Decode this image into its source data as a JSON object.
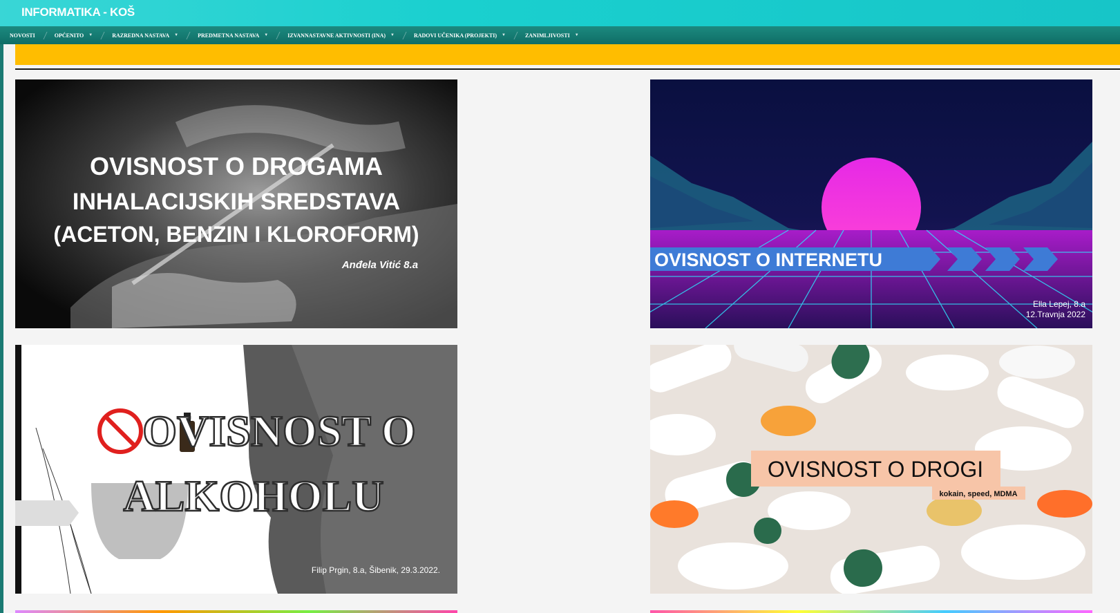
{
  "site": {
    "title": "INFORMATIKA - KOŠ"
  },
  "nav": {
    "items": [
      {
        "label": "NOVOSTI",
        "dropdown": false
      },
      {
        "label": "OPĆENITO",
        "dropdown": true
      },
      {
        "label": "RAZREDNA NASTAVA",
        "dropdown": true
      },
      {
        "label": "PREDMETNA NASTAVA",
        "dropdown": true
      },
      {
        "label": "IZVANNASTAVNE AKTIVNOSTI (INA)",
        "dropdown": true
      },
      {
        "label": "RADOVI UČENIKA (PROJEKTI)",
        "dropdown": true
      },
      {
        "label": "ZANIMLJIVOSTI",
        "dropdown": true
      }
    ],
    "caret": "▼"
  },
  "colors": {
    "topbar": "#1ad0cf",
    "navbar": "#0f6d66",
    "banner": "#ffbd00"
  },
  "cards": [
    {
      "line1": "OVISNOST O DROGAMA",
      "line2": "INHALACIJSKIH SREDSTAVA",
      "line3": "(ACETON, BENZIN I KLOROFORM)",
      "author": "Anđela Vitić 8.a"
    },
    {
      "title": "OVISNOST O INTERNETU",
      "author": "Ella Lepej, 8.a",
      "date": "12.Travnja 2022"
    },
    {
      "line1": "OVISNOST O",
      "line2": "ALKOHOLU",
      "author": "Filip Prgin, 8.a, Šibenik, 29.3.2022."
    },
    {
      "title": "OVISNOST O DROGI",
      "subtitle": "kokain, speed, MDMA"
    }
  ]
}
